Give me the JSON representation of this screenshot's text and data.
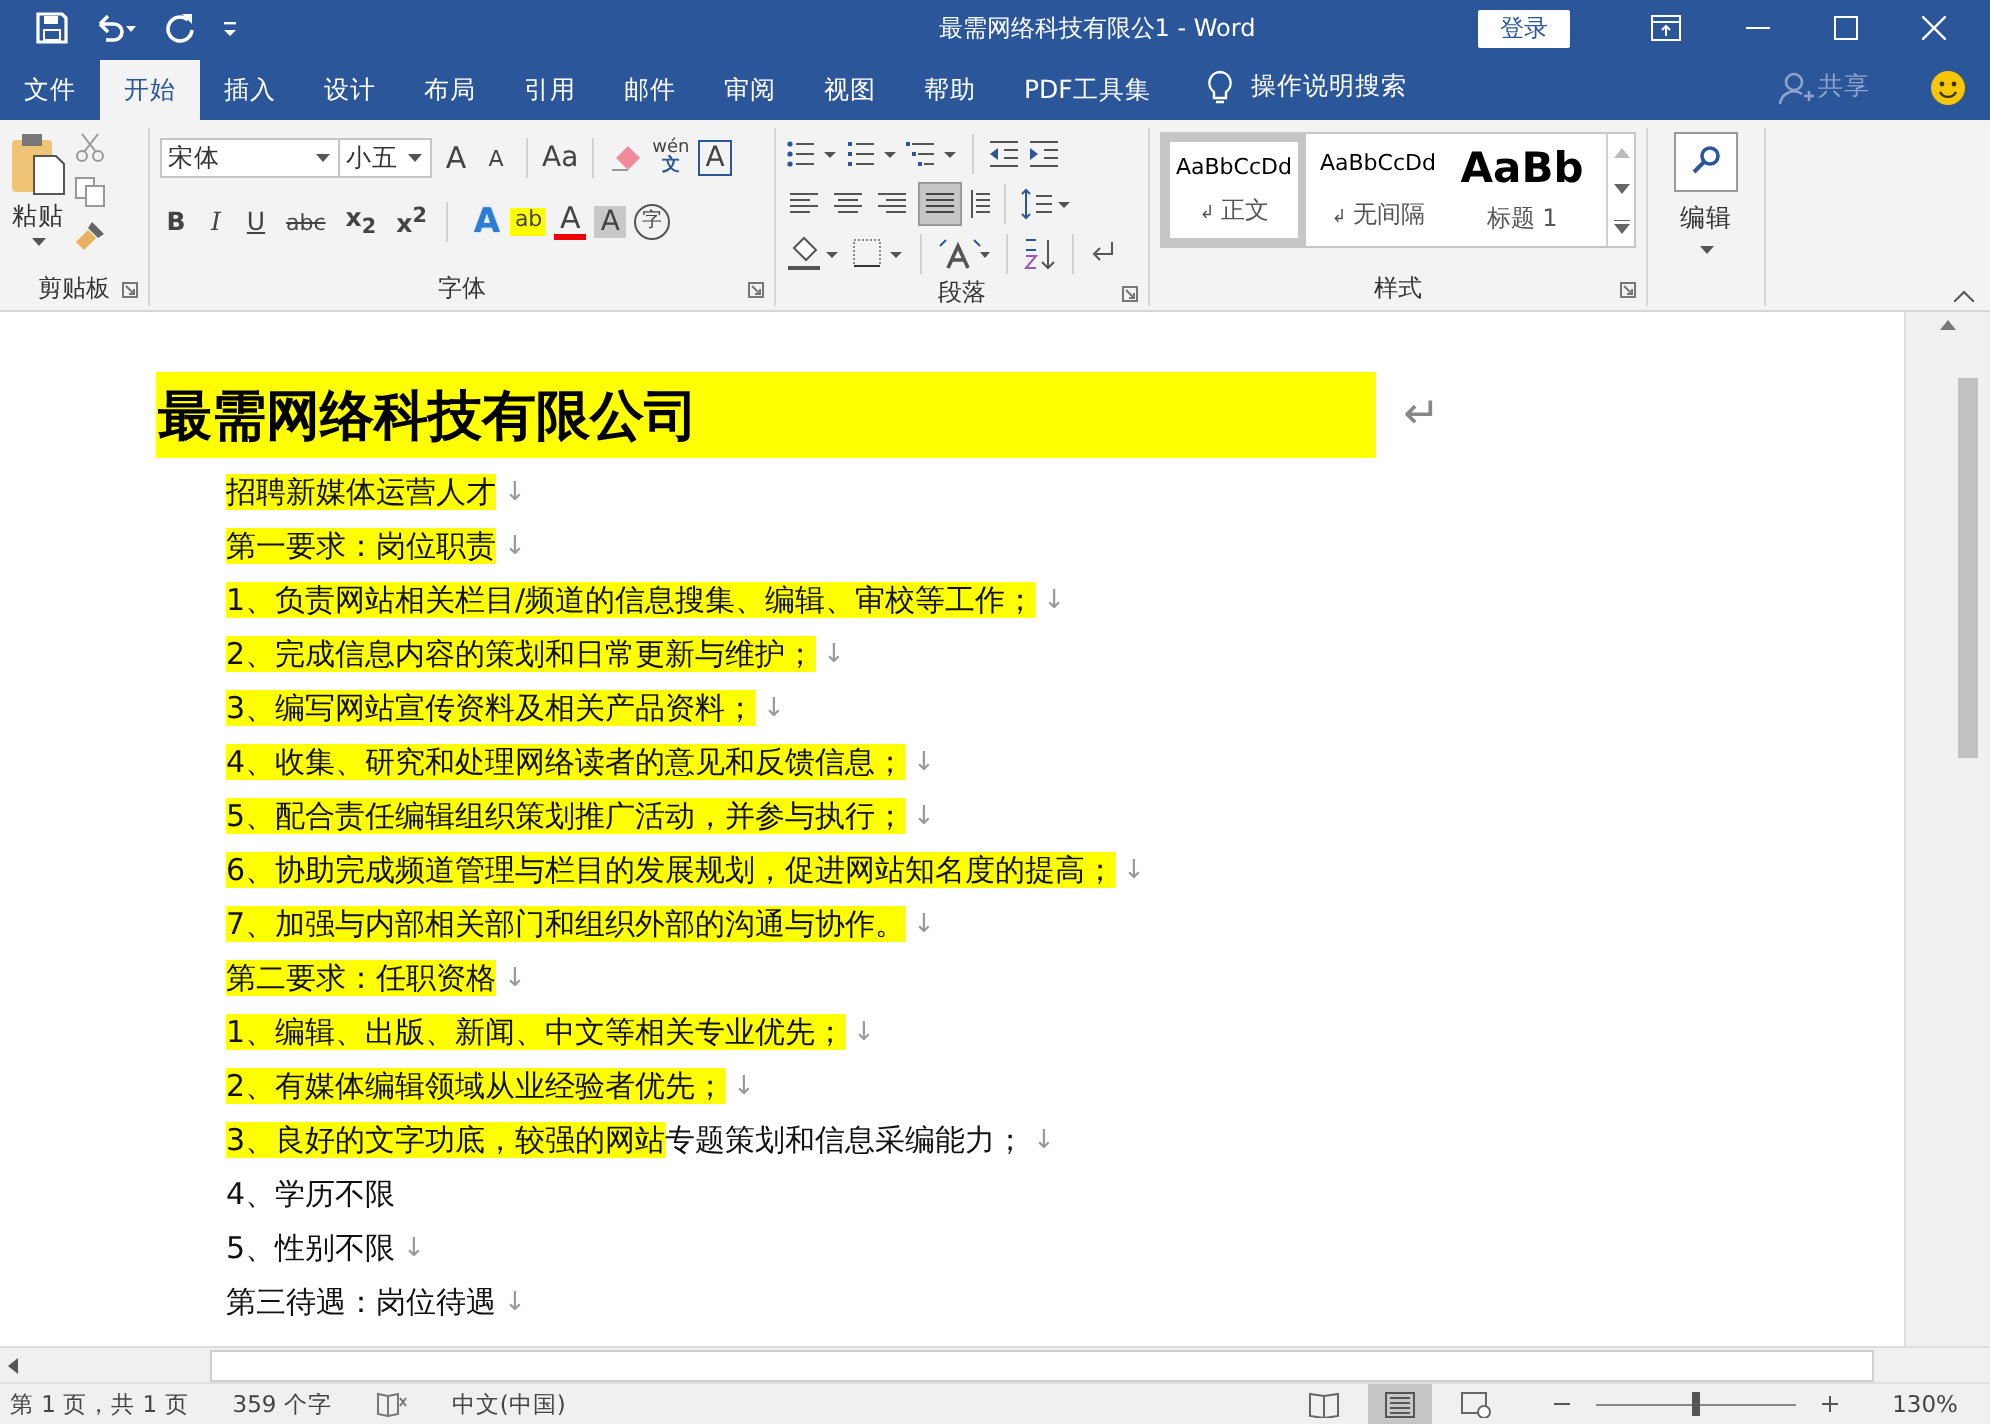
{
  "window": {
    "title": "最需网络科技有限公1  -  Word",
    "login_button": "登录"
  },
  "tabs": [
    {
      "label": "文件",
      "selected": false
    },
    {
      "label": "开始",
      "selected": true
    },
    {
      "label": "插入",
      "selected": false
    },
    {
      "label": "设计",
      "selected": false
    },
    {
      "label": "布局",
      "selected": false
    },
    {
      "label": "引用",
      "selected": false
    },
    {
      "label": "邮件",
      "selected": false
    },
    {
      "label": "审阅",
      "selected": false
    },
    {
      "label": "视图",
      "selected": false
    },
    {
      "label": "帮助",
      "selected": false
    },
    {
      "label": "PDF工具集",
      "selected": false
    }
  ],
  "tell_me": "操作说明搜索",
  "share": "共享",
  "ribbon": {
    "clipboard": {
      "paste": "粘贴",
      "label": "剪贴板"
    },
    "font": {
      "name": "宋体",
      "size": "小五",
      "grow": "A",
      "shrink": "A",
      "case": "Aa",
      "phonetic_top": "wén",
      "phonetic_bottom": "文",
      "border_char": "A",
      "format_buttons": [
        "B",
        "I",
        "U",
        "abc",
        "x$_{2}$",
        "x$^{2}$"
      ],
      "effect": "A",
      "highlight": "ab",
      "font_color_char": "A",
      "shading": "A",
      "enclose": "字",
      "label": "字体"
    },
    "paragraph": {
      "label": "段落"
    },
    "styles": {
      "items": [
        {
          "kind": "normal",
          "sample": "AaBbCcDd",
          "name": "正文",
          "mark": "↲",
          "selected": true
        },
        {
          "kind": "normal",
          "sample": "AaBbCcDd",
          "name": "无间隔",
          "mark": "↲",
          "selected": false
        },
        {
          "kind": "heading",
          "sample": "AaBb",
          "name": "标题 1",
          "selected": false
        }
      ],
      "label": "样式"
    },
    "editing": {
      "label": "编辑"
    }
  },
  "document": {
    "heading": {
      "text": "最需网络科技有限公司",
      "mark": "↵"
    },
    "lines": [
      {
        "highlighted": "招聘新媒体运营人才",
        "mark": "↓"
      },
      {
        "highlighted": "第一要求：岗位职责",
        "mark": "↓"
      },
      {
        "highlighted": "1、负责网站相关栏目/频道的信息搜集、编辑、审校等工作；",
        "mark": "↓"
      },
      {
        "highlighted": "2、完成信息内容的策划和日常更新与维护；",
        "mark": "↓"
      },
      {
        "highlighted": "3、编写网站宣传资料及相关产品资料；",
        "mark": "↓"
      },
      {
        "highlighted": "4、收集、研究和处理网络读者的意见和反馈信息；",
        "mark": "↓"
      },
      {
        "highlighted": "5、配合责任编辑组织策划推广活动，并参与执行；",
        "mark": "↓"
      },
      {
        "highlighted": "6、协助完成频道管理与栏目的发展规划，促进网站知名度的提高；",
        "mark": "↓"
      },
      {
        "highlighted": "7、加强与内部相关部门和组织外部的沟通与协作。",
        "mark": "↓"
      },
      {
        "highlighted": "第二要求：任职资格",
        "mark": "↓"
      },
      {
        "highlighted": "1、编辑、出版、新闻、中文等相关专业优先；",
        "mark": "↓"
      },
      {
        "highlighted": "2、有媒体编辑领域从业经验者优先；",
        "mark": "↓"
      },
      {
        "highlighted": "3、良好的文字功底，较强的网站",
        "plain": "专题策划和信息采编能力；",
        "mark": "↓"
      },
      {
        "plain": "4、学历不限"
      },
      {
        "plain": "5、性别不限",
        "mark": "↓"
      },
      {
        "plain": "第三待遇：岗位待遇",
        "mark": "↓"
      }
    ]
  },
  "status_bar": {
    "items": [
      "第 1 页，共 1 页",
      "359 个字",
      "中文(中国)"
    ],
    "views": [
      {
        "kind": "read",
        "selected": false
      },
      {
        "kind": "print",
        "selected": true
      },
      {
        "kind": "web",
        "selected": false
      }
    ],
    "zoom": {
      "level": 0.5,
      "reading": "130%"
    }
  }
}
